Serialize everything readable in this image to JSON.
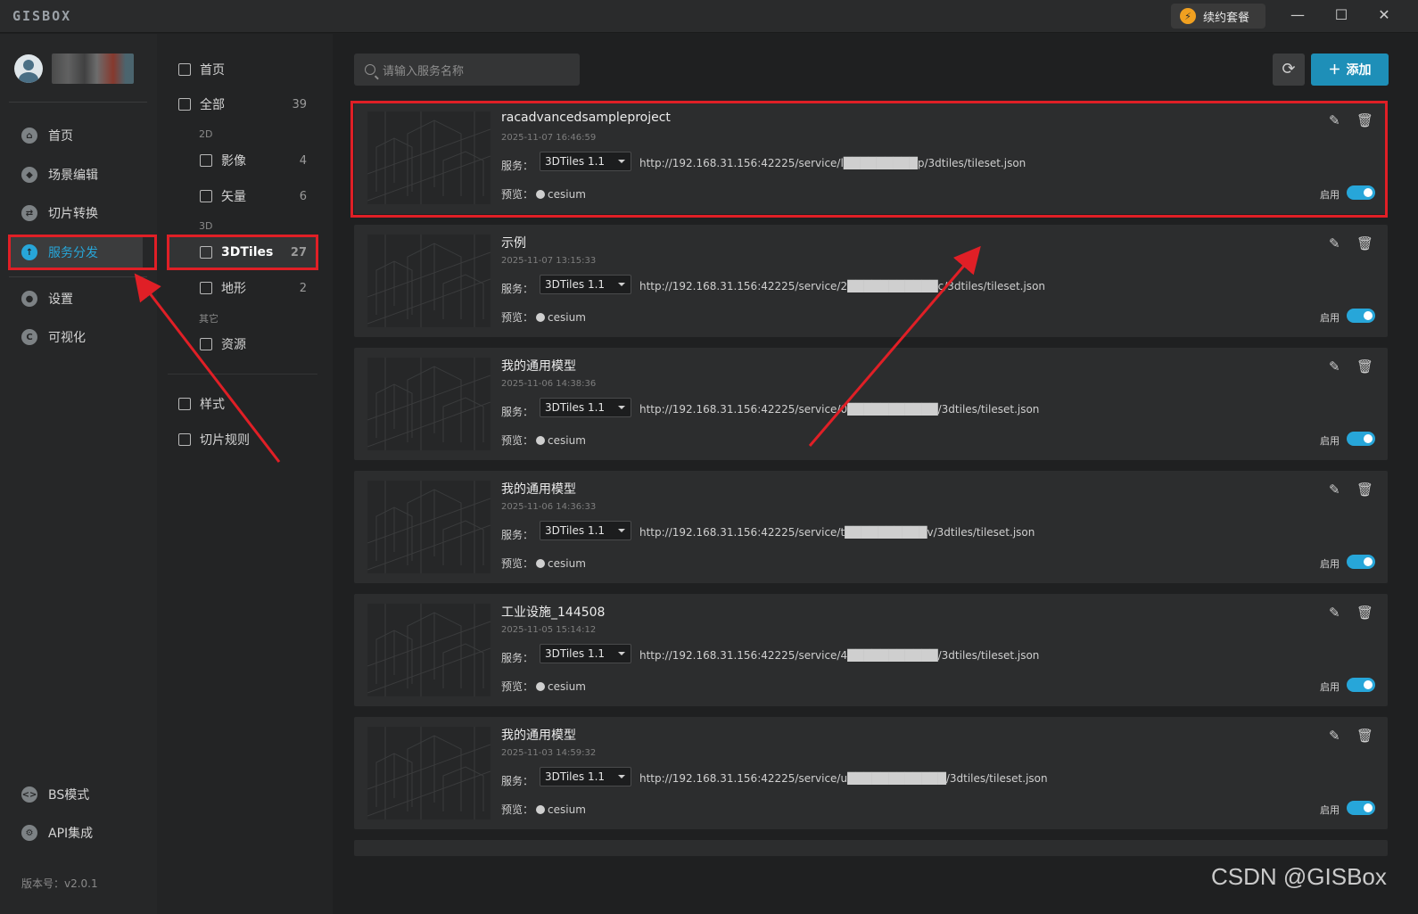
{
  "app": {
    "logo": "GISBOX",
    "renew_label": "续约套餐"
  },
  "window_controls": {
    "minimize": "—",
    "maximize": "☐",
    "close": "✕"
  },
  "sidebar": {
    "items": [
      {
        "label": "首页",
        "icon": "home-icon",
        "glyph": "⌂"
      },
      {
        "label": "场景编辑",
        "icon": "cube-icon",
        "glyph": "◆"
      },
      {
        "label": "切片转换",
        "icon": "convert-icon",
        "glyph": "⇄"
      },
      {
        "label": "服务分发",
        "icon": "upload-icon",
        "glyph": "↑",
        "active": true
      },
      {
        "label": "设置",
        "icon": "gear-icon",
        "glyph": "●"
      },
      {
        "label": "可视化",
        "icon": "visual-icon",
        "glyph": "C"
      }
    ],
    "bottom": [
      {
        "label": "BS模式",
        "icon": "code-icon",
        "glyph": "<>"
      },
      {
        "label": "API集成",
        "icon": "api-icon",
        "glyph": "⚙"
      }
    ],
    "version": "版本号：v2.0.1"
  },
  "subnav": {
    "home": "首页",
    "all": {
      "label": "全部",
      "count": "39"
    },
    "group_2d": "2D",
    "imagery": {
      "label": "影像",
      "count": "4"
    },
    "vector": {
      "label": "矢量",
      "count": "6"
    },
    "group_3d": "3D",
    "tiles3d": {
      "label": "3DTiles",
      "count": "27"
    },
    "terrain": {
      "label": "地形",
      "count": "2"
    },
    "group_other": "其它",
    "resource": {
      "label": "资源"
    },
    "style": {
      "label": "样式"
    },
    "slice_rules": {
      "label": "切片规则"
    }
  },
  "toolbar": {
    "search_placeholder": "请输入服务名称",
    "add_label": "添加",
    "refresh_glyph": "⟳"
  },
  "card_labels": {
    "service": "服务：",
    "preview": "预览：",
    "preview_value": "cesium",
    "enable": "启用",
    "format": "3DTiles 1.1"
  },
  "cards": [
    {
      "title": "racadvancedsampleproject",
      "time": "2025-11-07 16:46:59",
      "url": "http://192.168.31.156:42225/service/l█████████p/3dtiles/tileset.json"
    },
    {
      "title": "示例",
      "time": "2025-11-07 13:15:33",
      "url": "http://192.168.31.156:42225/service/2███████████c/3dtiles/tileset.json"
    },
    {
      "title": "我的通用模型",
      "time": "2025-11-06 14:38:36",
      "url": "http://192.168.31.156:42225/service/0███████████/3dtiles/tileset.json"
    },
    {
      "title": "我的通用模型",
      "time": "2025-11-06 14:36:33",
      "url": "http://192.168.31.156:42225/service/t██████████v/3dtiles/tileset.json"
    },
    {
      "title": "工业设施_144508",
      "time": "2025-11-05 15:14:12",
      "url": "http://192.168.31.156:42225/service/4███████████/3dtiles/tileset.json"
    },
    {
      "title": "我的通用模型",
      "time": "2025-11-03 14:59:32",
      "url": "http://192.168.31.156:42225/service/u████████████/3dtiles/tileset.json"
    }
  ],
  "colors": {
    "accent": "#27a6d9",
    "highlight": "#e01f26",
    "add_button": "#1e8fb8"
  },
  "watermark": "CSDN @GISBox"
}
